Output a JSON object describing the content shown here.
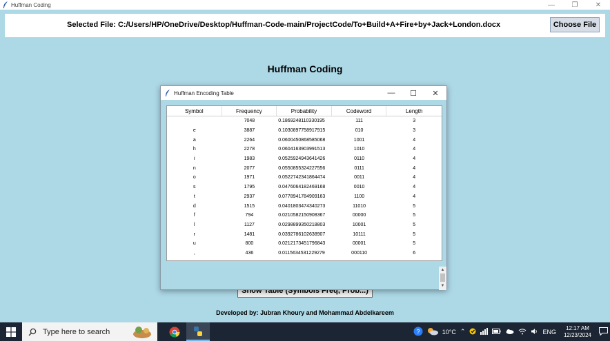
{
  "main_window": {
    "title": "Huffman Coding",
    "selected_file": "Selected File: C:/Users/HP/OneDrive/Desktop/Huffman-Code-main/ProjectCode/To+Build+A+Fire+by+Jack+London.docx",
    "choose_button": "Choose File",
    "heading": "Huffman Coding",
    "show_table_button": "Show Table (Symbols Freq, Prob...)",
    "developed_by": "Developed by: Jubran Khoury and Mohammad Abdelkareem"
  },
  "popup": {
    "title": "Huffman Encoding Table",
    "columns": [
      "Symbol",
      "Frequency",
      "Probability",
      "Codeword",
      "Length"
    ],
    "rows": [
      {
        "symbol": "",
        "frequency": "7048",
        "probability": "0.1869248110330195",
        "codeword": "111",
        "length": "3"
      },
      {
        "symbol": "e",
        "frequency": "3887",
        "probability": "0.1030897758917915",
        "codeword": "010",
        "length": "3"
      },
      {
        "symbol": "a",
        "frequency": "2264",
        "probability": "0.0600450868585068",
        "codeword": "1001",
        "length": "4"
      },
      {
        "symbol": "h",
        "frequency": "2278",
        "probability": "0.0604163903991513",
        "codeword": "1010",
        "length": "4"
      },
      {
        "symbol": "i",
        "frequency": "1983",
        "probability": "0.0525924943641426",
        "codeword": "0110",
        "length": "4"
      },
      {
        "symbol": "n",
        "frequency": "2077",
        "probability": "0.0550855324227556",
        "codeword": "0111",
        "length": "4"
      },
      {
        "symbol": "o",
        "frequency": "1971",
        "probability": "0.0522742341864474",
        "codeword": "0011",
        "length": "4"
      },
      {
        "symbol": "s",
        "frequency": "1795",
        "probability": "0.0476064182469168",
        "codeword": "0010",
        "length": "4"
      },
      {
        "symbol": "t",
        "frequency": "2937",
        "probability": "0.0778941784909163",
        "codeword": "1100",
        "length": "4"
      },
      {
        "symbol": "d",
        "frequency": "1515",
        "probability": "0.0401803474340273",
        "codeword": "11010",
        "length": "5"
      },
      {
        "symbol": "f",
        "frequency": "794",
        "probability": "0.0210582150908367",
        "codeword": "00000",
        "length": "5"
      },
      {
        "symbol": "l",
        "frequency": "1127",
        "probability": "0.0298899350218803",
        "codeword": "10001",
        "length": "5"
      },
      {
        "symbol": "r",
        "frequency": "1481",
        "probability": "0.0392786102638907",
        "codeword": "10111",
        "length": "5"
      },
      {
        "symbol": "u",
        "frequency": "800",
        "probability": "0.0212173451796843",
        "codeword": "00001",
        "length": "5"
      },
      {
        "symbol": ",",
        "frequency": "436",
        "probability": "0.0115634531229279",
        "codeword": "000110",
        "length": "6"
      }
    ]
  },
  "taskbar": {
    "search_placeholder": "Type here to search",
    "weather": "10°C",
    "language": "ENG",
    "time": "12:17 AM",
    "date": "12/23/2024"
  },
  "colors": {
    "background": "#add8e6",
    "taskbar": "#1c2533"
  }
}
